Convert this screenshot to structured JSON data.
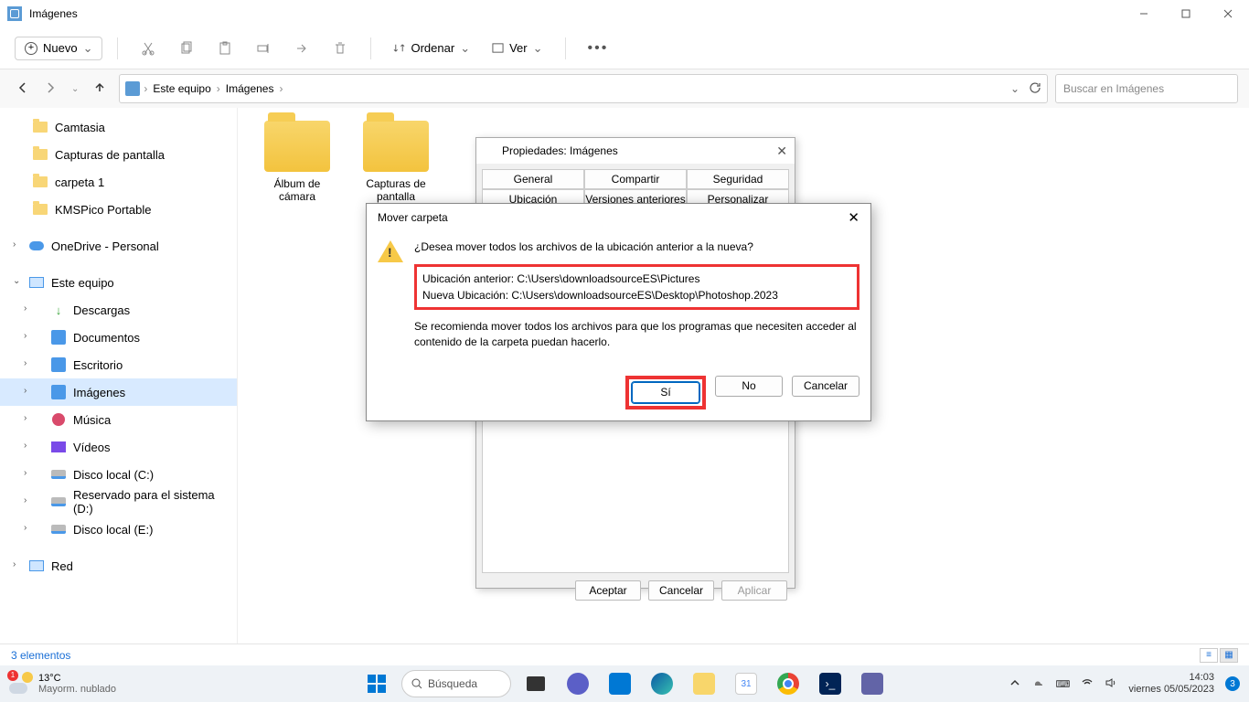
{
  "window": {
    "title": "Imágenes"
  },
  "toolbar": {
    "new": "Nuevo",
    "sort": "Ordenar",
    "view": "Ver"
  },
  "breadcrumb": {
    "root": "Este equipo",
    "current": "Imágenes"
  },
  "search": {
    "placeholder": "Buscar en Imágenes"
  },
  "sidebar": {
    "quick": [
      {
        "label": "Camtasia"
      },
      {
        "label": "Capturas de pantalla"
      },
      {
        "label": "carpeta 1"
      },
      {
        "label": "KMSPico Portable"
      }
    ],
    "onedrive": "OneDrive - Personal",
    "thispc": "Este equipo",
    "thispc_children": [
      {
        "label": "Descargas"
      },
      {
        "label": "Documentos"
      },
      {
        "label": "Escritorio"
      },
      {
        "label": "Imágenes"
      },
      {
        "label": "Música"
      },
      {
        "label": "Vídeos"
      },
      {
        "label": "Disco local (C:)"
      },
      {
        "label": "Reservado para el sistema (D:)"
      },
      {
        "label": "Disco local (E:)"
      }
    ],
    "network": "Red"
  },
  "folders": [
    {
      "label": "Álbum de cámara"
    },
    {
      "label": "Capturas de pantalla"
    }
  ],
  "status": {
    "count": "3 elementos"
  },
  "properties": {
    "title": "Propiedades: Imágenes",
    "tabs": {
      "general": "General",
      "share": "Compartir",
      "security": "Seguridad",
      "location": "Ubicación",
      "previous": "Versiones anteriores",
      "customize": "Personalizar"
    },
    "ok": "Aceptar",
    "cancel": "Cancelar",
    "apply": "Aplicar"
  },
  "move_dialog": {
    "title": "Mover carpeta",
    "question": "¿Desea mover todos los archivos de la ubicación anterior a la nueva?",
    "prev_label": "Ubicación anterior: C:\\Users\\downloadsourceES\\Pictures",
    "new_label": "Nueva Ubicación: C:\\Users\\downloadsourceES\\Desktop\\Photoshop.2023",
    "recommend": "Se recomienda mover todos los archivos para que los programas que necesiten acceder al contenido de la carpeta puedan hacerlo.",
    "yes": "Sí",
    "no": "No",
    "cancel": "Cancelar"
  },
  "taskbar": {
    "temp": "13°C",
    "weather": "Mayorm. nublado",
    "weather_badge": "1",
    "search": "Búsqueda",
    "time": "14:03",
    "date": "viernes 05/05/2023",
    "notif_count": "3"
  }
}
